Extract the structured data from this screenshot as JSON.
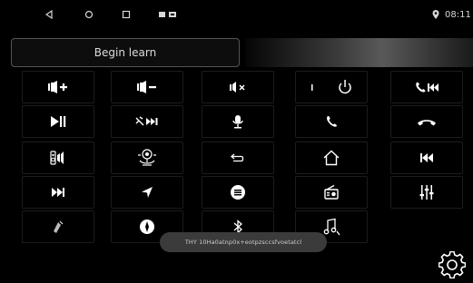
{
  "status_bar": {
    "nav_icons": [
      "back-icon",
      "home-icon",
      "recents-icon",
      "notification-icons"
    ],
    "location_icon": "location-pin-icon",
    "time": "08:11"
  },
  "learn": {
    "button_label": "Begin learn"
  },
  "keys": [
    "volume-up-icon",
    "volume-down-icon",
    "mute-icon",
    "power-icon",
    "call-previous-icon",
    "play-pause-icon",
    "mute-next-icon",
    "microphone-icon",
    "phone-answer-icon",
    "phone-hangup-icon",
    "speaker-icon",
    "navigation-mode-icon",
    "back-icon",
    "home-icon",
    "previous-track-icon",
    "next-track-icon",
    "navigation-arrow-icon",
    "menu-circle-icon",
    "radio-icon",
    "equalizer-icon",
    "assistant-icon",
    "compass-icon",
    "bluetooth-icon",
    "music-note-icon"
  ],
  "toast": {
    "text": "THY 10Ha0atnp0x+eotpzsccsfvoetatcl"
  },
  "settings": {
    "icon": "gear-icon"
  },
  "colors": {
    "background": "#000000",
    "icon": "#ffffff",
    "key_border": "#1c1c1c",
    "toast": "#3b3b3b"
  }
}
